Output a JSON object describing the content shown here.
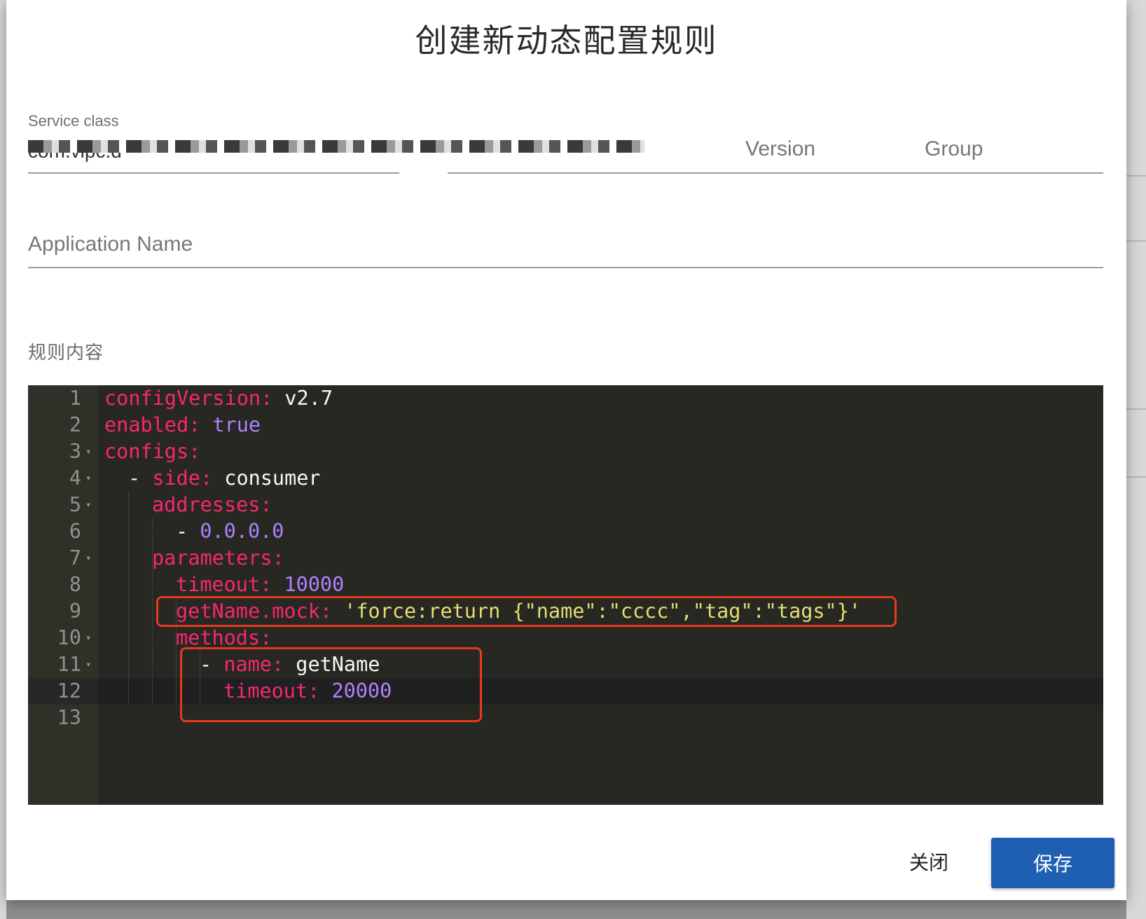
{
  "dialog": {
    "title": "创建新动态配置规则",
    "service_class_label": "Service class",
    "service_class_value_visible": "com.vipc.d",
    "version_placeholder": "Version",
    "group_placeholder": "Group",
    "application_placeholder": "Application Name",
    "rule_content_label": "规则内容"
  },
  "editor": {
    "language": "yaml",
    "theme": "monokai",
    "active_line": 12,
    "lines": [
      {
        "n": "1",
        "fold": false,
        "indent": 0,
        "tokens": [
          {
            "t": "configVersion:",
            "c": "k"
          },
          {
            "t": " v2.7",
            "c": "v"
          }
        ]
      },
      {
        "n": "2",
        "fold": false,
        "indent": 0,
        "tokens": [
          {
            "t": "enabled:",
            "c": "k"
          },
          {
            "t": " true",
            "c": "c"
          }
        ]
      },
      {
        "n": "3",
        "fold": true,
        "indent": 0,
        "tokens": [
          {
            "t": "configs:",
            "c": "k"
          }
        ]
      },
      {
        "n": "4",
        "fold": true,
        "indent": 1,
        "tokens": [
          {
            "t": "- ",
            "c": "v"
          },
          {
            "t": "side:",
            "c": "k"
          },
          {
            "t": " consumer",
            "c": "v"
          }
        ]
      },
      {
        "n": "5",
        "fold": true,
        "indent": 2,
        "tokens": [
          {
            "t": "addresses:",
            "c": "k"
          }
        ]
      },
      {
        "n": "6",
        "fold": false,
        "indent": 3,
        "tokens": [
          {
            "t": "- ",
            "c": "v"
          },
          {
            "t": "0.0.0.0",
            "c": "c"
          }
        ]
      },
      {
        "n": "7",
        "fold": true,
        "indent": 2,
        "tokens": [
          {
            "t": "parameters:",
            "c": "k"
          }
        ]
      },
      {
        "n": "8",
        "fold": false,
        "indent": 3,
        "tokens": [
          {
            "t": "timeout:",
            "c": "k"
          },
          {
            "t": " 10000",
            "c": "c"
          }
        ]
      },
      {
        "n": "9",
        "fold": false,
        "indent": 3,
        "tokens": [
          {
            "t": "getName.mock:",
            "c": "k"
          },
          {
            "t": " 'force:return {\"name\":\"cccc\",\"tag\":\"tags\"}'",
            "c": "s"
          }
        ]
      },
      {
        "n": "10",
        "fold": true,
        "indent": 3,
        "tokens": [
          {
            "t": "methods:",
            "c": "k"
          }
        ]
      },
      {
        "n": "11",
        "fold": true,
        "indent": 4,
        "tokens": [
          {
            "t": "- ",
            "c": "v"
          },
          {
            "t": "name:",
            "c": "k"
          },
          {
            "t": " getName",
            "c": "v"
          }
        ]
      },
      {
        "n": "12",
        "fold": false,
        "indent": 5,
        "tokens": [
          {
            "t": "timeout:",
            "c": "k"
          },
          {
            "t": " 20000",
            "c": "c"
          }
        ]
      },
      {
        "n": "13",
        "fold": false,
        "indent": 0,
        "tokens": []
      }
    ]
  },
  "buttons": {
    "close_label": "关闭",
    "save_label": "保存"
  },
  "colors": {
    "primary": "#1f5fb3",
    "editor_bg": "#272822",
    "key": "#f92672",
    "constant": "#ae81ff",
    "string": "#e6db74",
    "annotation_box": "#e53a1f"
  }
}
